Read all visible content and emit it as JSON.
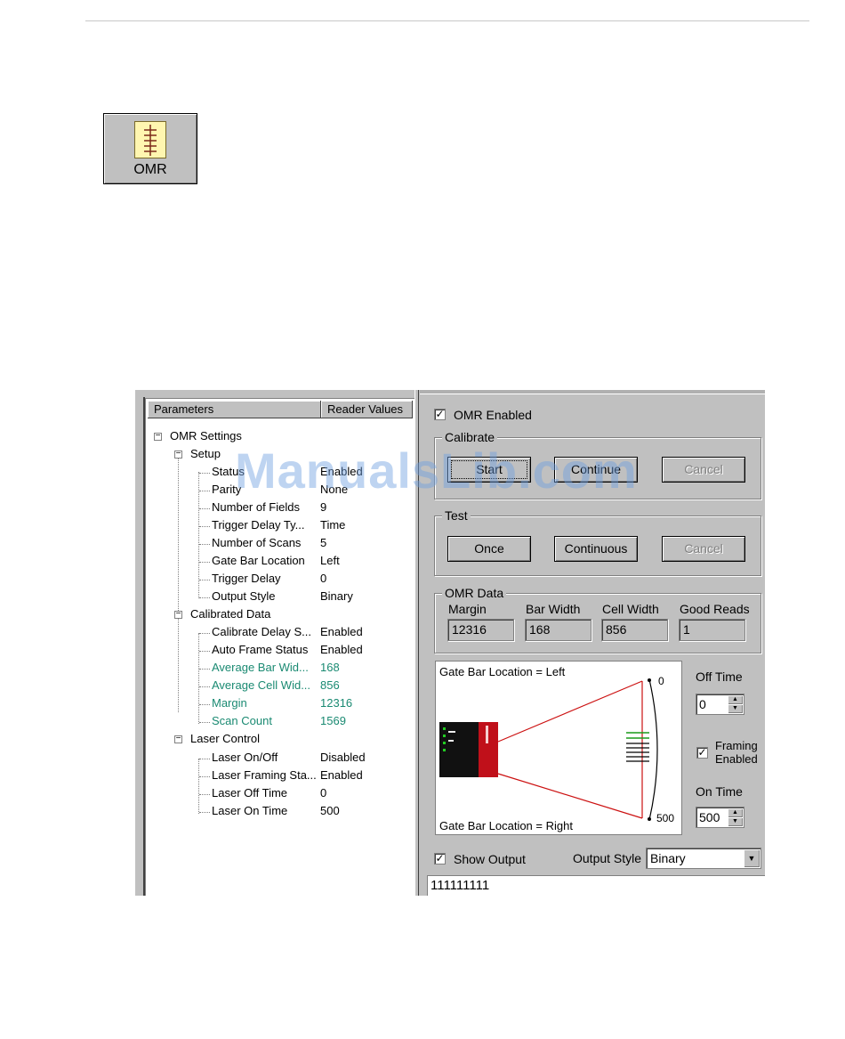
{
  "icon": {
    "label": "OMR"
  },
  "tree": {
    "headers": [
      "Parameters",
      "Reader Values"
    ],
    "root": "OMR Settings",
    "groups": [
      {
        "label": "Setup",
        "items": [
          {
            "name": "Status",
            "value": "Enabled"
          },
          {
            "name": "Parity",
            "value": "None"
          },
          {
            "name": "Number of Fields",
            "value": "9"
          },
          {
            "name": "Trigger Delay Ty...",
            "value": "Time"
          },
          {
            "name": "Number of Scans",
            "value": "5"
          },
          {
            "name": "Gate Bar Location",
            "value": "Left"
          },
          {
            "name": "Trigger Delay",
            "value": "0"
          },
          {
            "name": "Output Style",
            "value": "Binary"
          }
        ]
      },
      {
        "label": "Calibrated Data",
        "items": [
          {
            "name": "Calibrate Delay S...",
            "value": "Enabled"
          },
          {
            "name": "Auto Frame Status",
            "value": "Enabled"
          },
          {
            "name": "Average Bar Wid...",
            "value": "168"
          },
          {
            "name": "Average Cell Wid...",
            "value": "856"
          },
          {
            "name": "Margin",
            "value": "12316"
          },
          {
            "name": "Scan Count",
            "value": "1569"
          }
        ]
      },
      {
        "label": "Laser Control",
        "items": [
          {
            "name": "Laser On/Off",
            "value": "Disabled"
          },
          {
            "name": "Laser Framing Sta...",
            "value": "Enabled"
          },
          {
            "name": "Laser Off Time",
            "value": "0"
          },
          {
            "name": "Laser On Time",
            "value": "500"
          }
        ]
      }
    ]
  },
  "panel": {
    "omr_enabled_label": "OMR Enabled",
    "calibrate": {
      "title": "Calibrate",
      "start": "Start",
      "continue": "Continue",
      "cancel": "Cancel"
    },
    "test": {
      "title": "Test",
      "once": "Once",
      "continuous": "Continuous",
      "cancel": "Cancel"
    },
    "omr_data": {
      "title": "OMR Data",
      "margin_label": "Margin",
      "margin": "12316",
      "bar_width_label": "Bar Width",
      "bar_width": "168",
      "cell_width_label": "Cell Width",
      "cell_width": "856",
      "good_reads_label": "Good Reads",
      "good_reads": "1"
    },
    "diagram": {
      "top_label": "Gate Bar Location = Left",
      "bottom_label": "Gate Bar Location = Right",
      "scale_top": "0",
      "scale_bottom": "500"
    },
    "off_time_label": "Off Time",
    "off_time": "0",
    "framing_label_1": "Framing",
    "framing_label_2": "Enabled",
    "on_time_label": "On Time",
    "on_time": "500",
    "show_output_label": "Show Output",
    "output_style_label": "Output Style",
    "output_style": "Binary",
    "output_value": "111111111"
  },
  "watermark": "ManualsLib.com",
  "colors": {
    "dialog": "#c0c0c0",
    "green_text": "#1a8a72",
    "laser_red": "#cc1111",
    "watermark": "#6ea0e1"
  }
}
